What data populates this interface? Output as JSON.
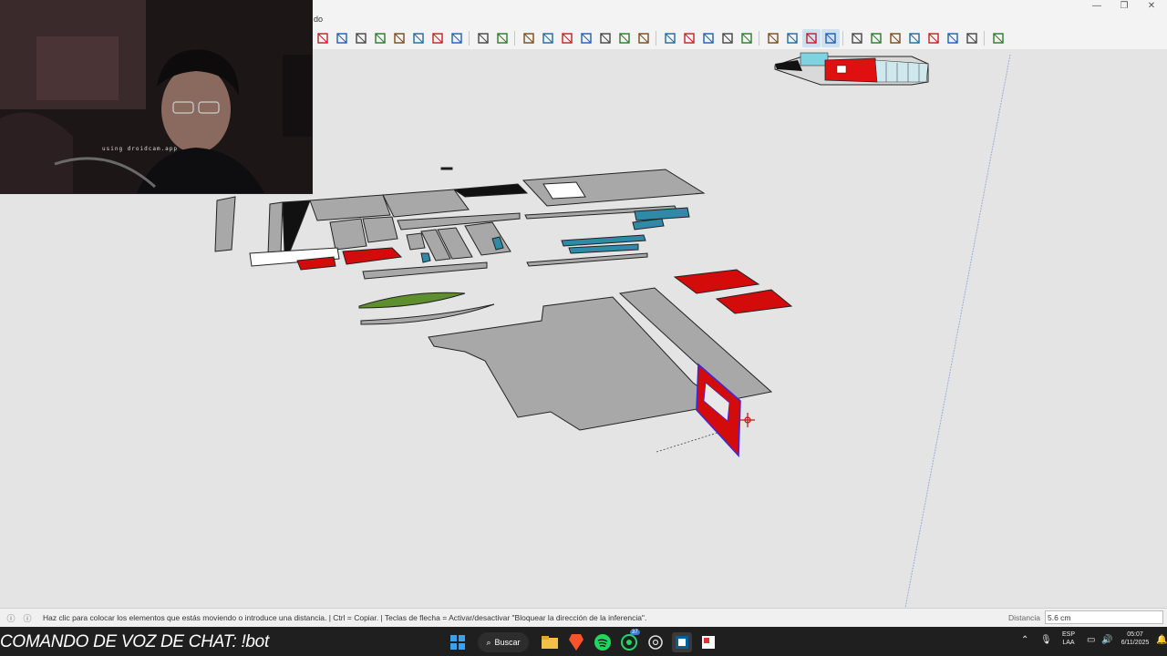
{
  "window": {
    "title_fragment": "do",
    "controls": [
      "—",
      "❐",
      "✕"
    ]
  },
  "toolbar": {
    "buttons": [
      {
        "name": "rotate-icon",
        "active": false
      },
      {
        "name": "move-icon",
        "active": false
      },
      {
        "name": "pushpull-icon",
        "active": false
      },
      {
        "name": "zoom-icon",
        "active": false
      },
      {
        "name": "zoom-extents-icon",
        "active": false
      },
      {
        "name": "orbit-icon",
        "active": false
      },
      {
        "name": "section-plane-icon",
        "active": false
      },
      {
        "name": "section-display-icon",
        "active": false
      },
      {
        "name": "section-cut-icon",
        "active": false
      },
      {
        "name": "position-camera-icon",
        "active": false
      },
      {
        "name": "iso-view-icon",
        "active": false
      },
      {
        "name": "top-view-icon",
        "active": false
      },
      {
        "name": "front-view-icon",
        "active": false
      },
      {
        "name": "right-view-icon",
        "active": false
      },
      {
        "name": "back-view-icon",
        "active": false
      },
      {
        "name": "left-view-icon",
        "active": false
      },
      {
        "name": "bottom-view-icon",
        "active": false
      },
      {
        "name": "component-icon",
        "active": false
      },
      {
        "name": "group-icon",
        "active": false
      },
      {
        "name": "paint-icon",
        "active": false
      },
      {
        "name": "tape-icon",
        "active": false
      },
      {
        "name": "outliner-icon",
        "active": false
      },
      {
        "name": "xray-icon",
        "active": false
      },
      {
        "name": "wireframe-icon",
        "active": false
      },
      {
        "name": "hidden-line-icon",
        "active": true
      },
      {
        "name": "shaded-icon",
        "active": true
      },
      {
        "name": "sandbox-icon",
        "active": false
      },
      {
        "name": "smoove-icon",
        "active": false
      },
      {
        "name": "stamp-icon",
        "active": false
      },
      {
        "name": "drape-icon",
        "active": false
      },
      {
        "name": "add-detail-icon",
        "active": false
      },
      {
        "name": "flip-edge-icon",
        "active": false
      },
      {
        "name": "terrain-icon",
        "active": false
      },
      {
        "name": "extension-logo-icon",
        "active": false
      }
    ]
  },
  "webcam": {
    "overlay_text": "using droidcam.app"
  },
  "status": {
    "message": "Haz clic para colocar los elementos que estás moviendo o introduce una distancia. | Ctrl = Copiar. | Teclas de flecha = Activar/desactivar \"Bloquear la dirección de la inferencia\".",
    "distance_label": "Distancia",
    "distance_value": "5.6 cm"
  },
  "overlay": {
    "chat_command": "COMANDO DE VOZ DE CHAT: !bot"
  },
  "taskbar": {
    "search_label": "Buscar",
    "apps": [
      "windows-start-icon",
      "file-explorer-icon",
      "brave-browser-icon",
      "spotify-icon",
      "whatsapp-icon",
      "chatgpt-icon",
      "sketchup-icon",
      "layout-icon"
    ],
    "whatsapp_badge": "37",
    "language": "ESP",
    "language_sub": "LAA",
    "time": "05:07",
    "date": "6/11/2025"
  },
  "colors": {
    "selection_red": "#d40b0b",
    "selection_outline": "#3a2bd4",
    "surface_gray": "#a8a8a8",
    "accent_teal": "#2e8aa6",
    "accent_green": "#5d8f2e"
  }
}
